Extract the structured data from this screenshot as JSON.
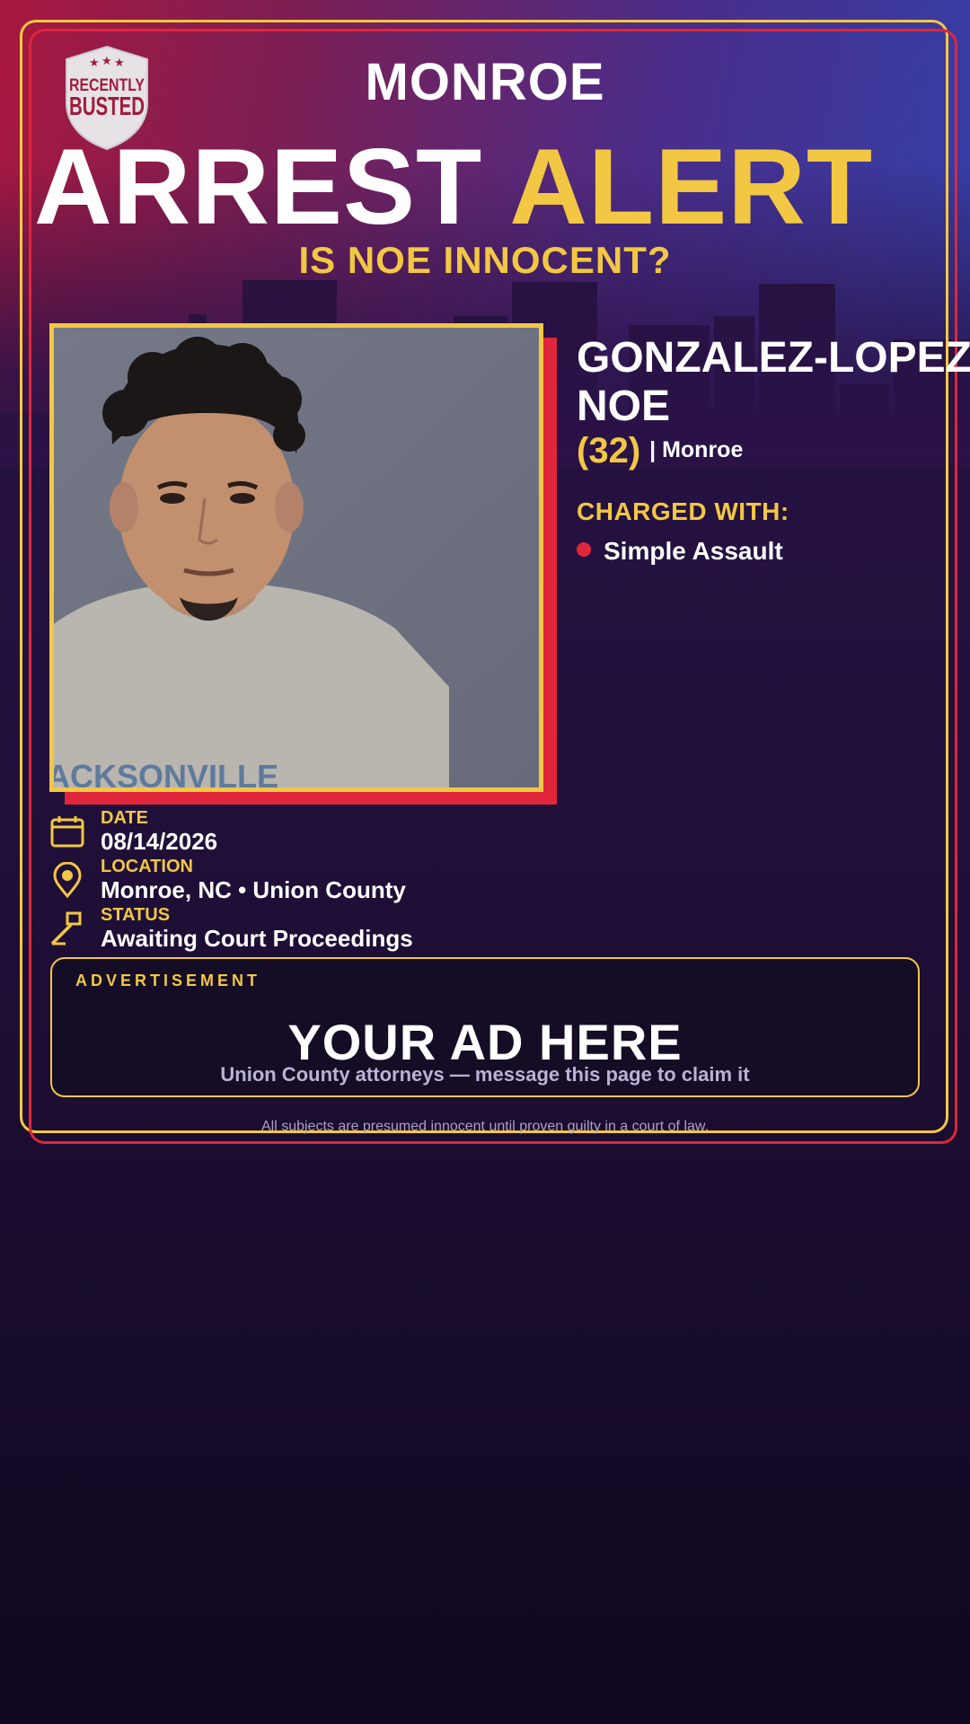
{
  "header": {
    "badge_line1": "RECENTLY",
    "badge_line2": "BUSTED",
    "city": "MONROE",
    "headline_white": "ARREST",
    "headline_yellow": "ALERT",
    "question": "IS NOE INNOCENT?"
  },
  "subject": {
    "last_name": "GONZALEZ-LOPEZ",
    "first_name": "NOE",
    "age": "(32)",
    "town": "| Monroe",
    "photo_shirt_text": "ACKSONVILLE"
  },
  "charges": {
    "label": "CHARGED WITH:",
    "items": [
      "Simple Assault"
    ]
  },
  "details": {
    "date_label": "DATE",
    "date_value": "08/14/2026",
    "location_label": "LOCATION",
    "location_value": "Monroe, NC • Union County",
    "status_label": "STATUS",
    "status_value": "Awaiting Court Proceedings"
  },
  "ad": {
    "label": "ADVERTISEMENT",
    "title": "YOUR AD HERE",
    "subtitle": "Union County attorneys — message this page to claim it"
  },
  "footer": {
    "disclaimer": "All subjects are presumed innocent until proven guilty in a court of law."
  },
  "colors": {
    "accent_yellow": "#f2c744",
    "accent_red": "#e0263a",
    "background_dark": "#1a0c2e"
  },
  "icons": [
    "shield-badge-icon",
    "calendar-icon",
    "location-pin-icon",
    "gavel-icon"
  ]
}
